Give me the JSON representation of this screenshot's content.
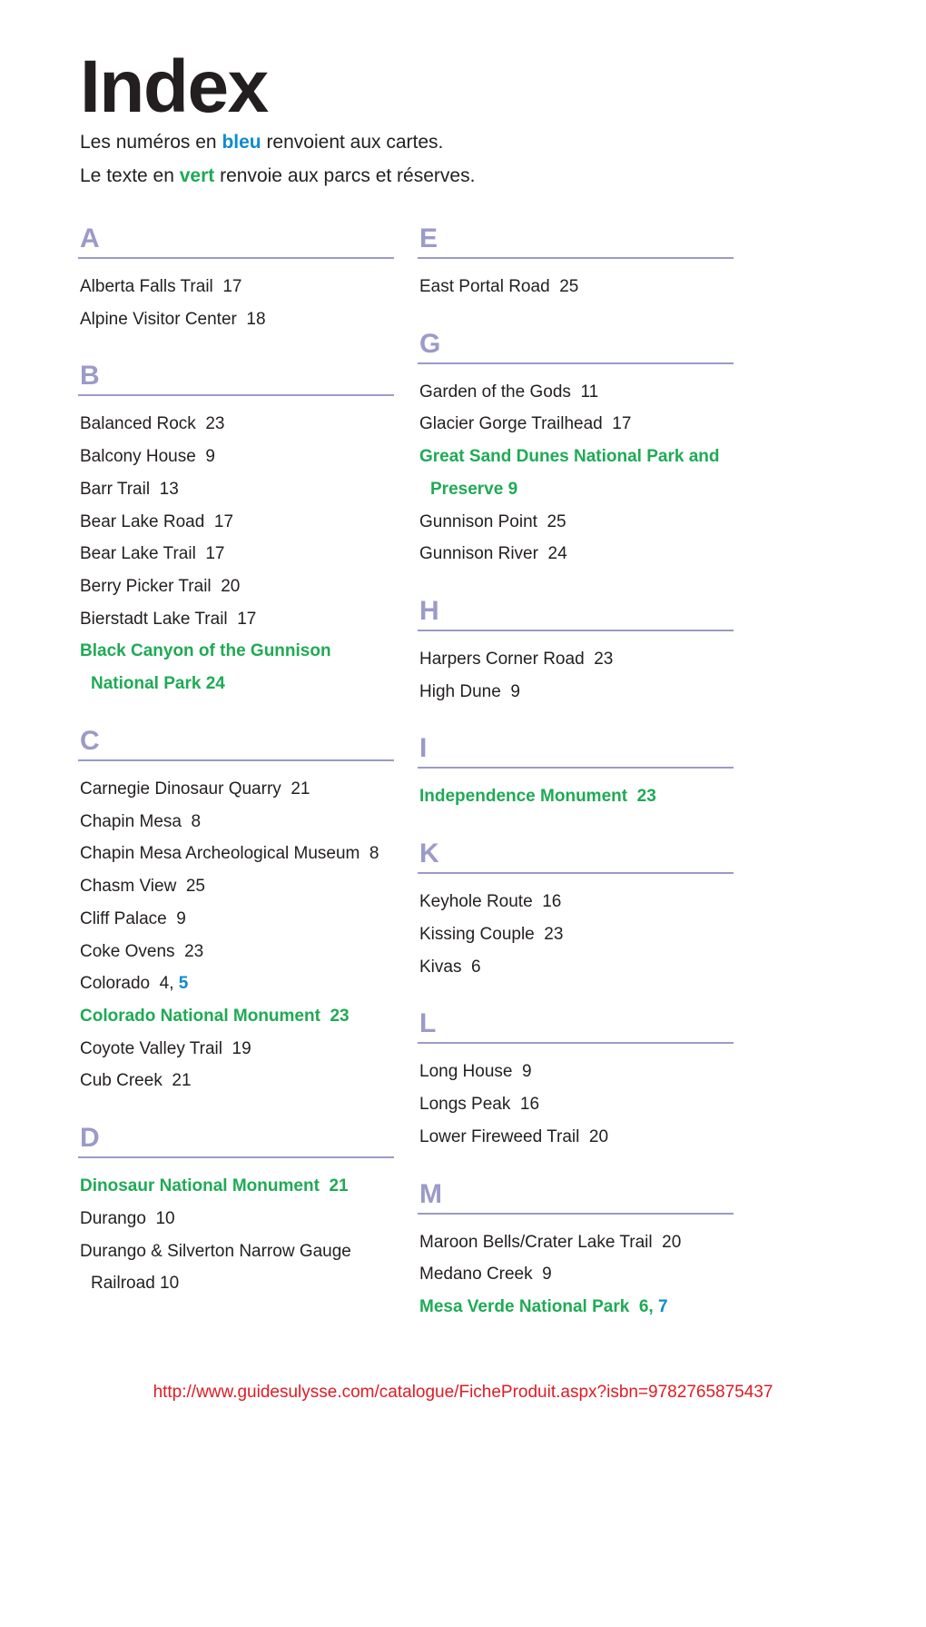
{
  "header": {
    "title": "Index",
    "legend_line1_pre": "Les numéros en ",
    "legend_line1_kw": "bleu",
    "legend_line1_post": " renvoient aux cartes.",
    "legend_line2_pre": "Le texte en ",
    "legend_line2_kw": "vert",
    "legend_line2_post": " renvoie aux parcs et réserves."
  },
  "colors": {
    "section_letter": "#9b9ac9",
    "rule": "#9b9ac9",
    "park_green": "#1faa55",
    "map_blue": "#0e8bd0",
    "text": "#231f20",
    "url_red": "#e01b24"
  },
  "columns": [
    {
      "id": "left",
      "sections": [
        {
          "letter": "A",
          "entries": [
            {
              "line1": "Alberta Falls Trail  17",
              "green": false
            },
            {
              "line1": "Alpine Visitor Center  18",
              "green": false
            }
          ]
        },
        {
          "letter": "B",
          "entries": [
            {
              "line1": "Balanced Rock  23",
              "green": false
            },
            {
              "line1": "Balcony House  9",
              "green": false
            },
            {
              "line1": "Barr Trail  13",
              "green": false
            },
            {
              "line1": "Bear Lake Road  17",
              "green": false
            },
            {
              "line1": "Bear Lake Trail  17",
              "green": false
            },
            {
              "line1": "Berry Picker Trail  20",
              "green": false
            },
            {
              "line1": "Bierstadt Lake Trail  17",
              "green": false
            },
            {
              "line1": "Black Canyon of the Gunnison",
              "line2": "National Park  24",
              "green": true
            }
          ]
        },
        {
          "letter": "C",
          "entries": [
            {
              "line1": "Carnegie Dinosaur Quarry  21",
              "green": false
            },
            {
              "line1": "Chapin Mesa  8",
              "green": false
            },
            {
              "line1": "Chapin Mesa Archeological Museum  8",
              "green": false
            },
            {
              "line1": "Chasm View  25",
              "green": false
            },
            {
              "line1": "Cliff Palace  9",
              "green": false
            },
            {
              "line1": "Coke Ovens  23",
              "green": false
            },
            {
              "line1": "Colorado  4, ",
              "blue_suffix": "5",
              "green": false
            },
            {
              "line1": "Colorado National Monument  23",
              "green": true
            },
            {
              "line1": "Coyote Valley Trail  19",
              "green": false
            },
            {
              "line1": "Cub Creek  21",
              "green": false
            }
          ]
        },
        {
          "letter": "D",
          "entries": [
            {
              "line1": "Dinosaur National Monument  21",
              "green": true
            },
            {
              "line1": "Durango  10",
              "green": false
            },
            {
              "line1": "Durango & Silverton Narrow Gauge",
              "line2": "Railroad  10",
              "green": false
            }
          ]
        }
      ]
    },
    {
      "id": "right",
      "sections": [
        {
          "letter": "E",
          "entries": [
            {
              "line1": "East Portal Road  25",
              "green": false
            }
          ]
        },
        {
          "letter": "G",
          "entries": [
            {
              "line1": "Garden of the Gods  11",
              "green": false
            },
            {
              "line1": "Glacier Gorge Trailhead  17",
              "green": false
            },
            {
              "line1": "Great Sand Dunes National Park and",
              "line2": "Preserve  9",
              "green": true
            },
            {
              "line1": "Gunnison Point  25",
              "green": false
            },
            {
              "line1": "Gunnison River  24",
              "green": false
            }
          ]
        },
        {
          "letter": "H",
          "entries": [
            {
              "line1": "Harpers Corner Road  23",
              "green": false
            },
            {
              "line1": "High Dune  9",
              "green": false
            }
          ]
        },
        {
          "letter": "I",
          "entries": [
            {
              "line1": "Independence Monument  23",
              "green": true
            }
          ]
        },
        {
          "letter": "K",
          "entries": [
            {
              "line1": "Keyhole Route  16",
              "green": false
            },
            {
              "line1": "Kissing Couple  23",
              "green": false
            },
            {
              "line1": "Kivas  6",
              "green": false
            }
          ]
        },
        {
          "letter": "L",
          "entries": [
            {
              "line1": "Long House  9",
              "green": false
            },
            {
              "line1": "Longs Peak  16",
              "green": false
            },
            {
              "line1": "Lower Fireweed Trail  20",
              "green": false
            }
          ]
        },
        {
          "letter": "M",
          "entries": [
            {
              "line1": "Maroon Bells/Crater Lake Trail  20",
              "green": false
            },
            {
              "line1": "Medano Creek  9",
              "green": false
            },
            {
              "line1": "Mesa Verde National Park  6, ",
              "blue_suffix": "7",
              "green": true
            }
          ]
        }
      ]
    }
  ],
  "footer": {
    "url": "http://www.guidesulysse.com/catalogue/FicheProduit.aspx?isbn=9782765875437"
  }
}
